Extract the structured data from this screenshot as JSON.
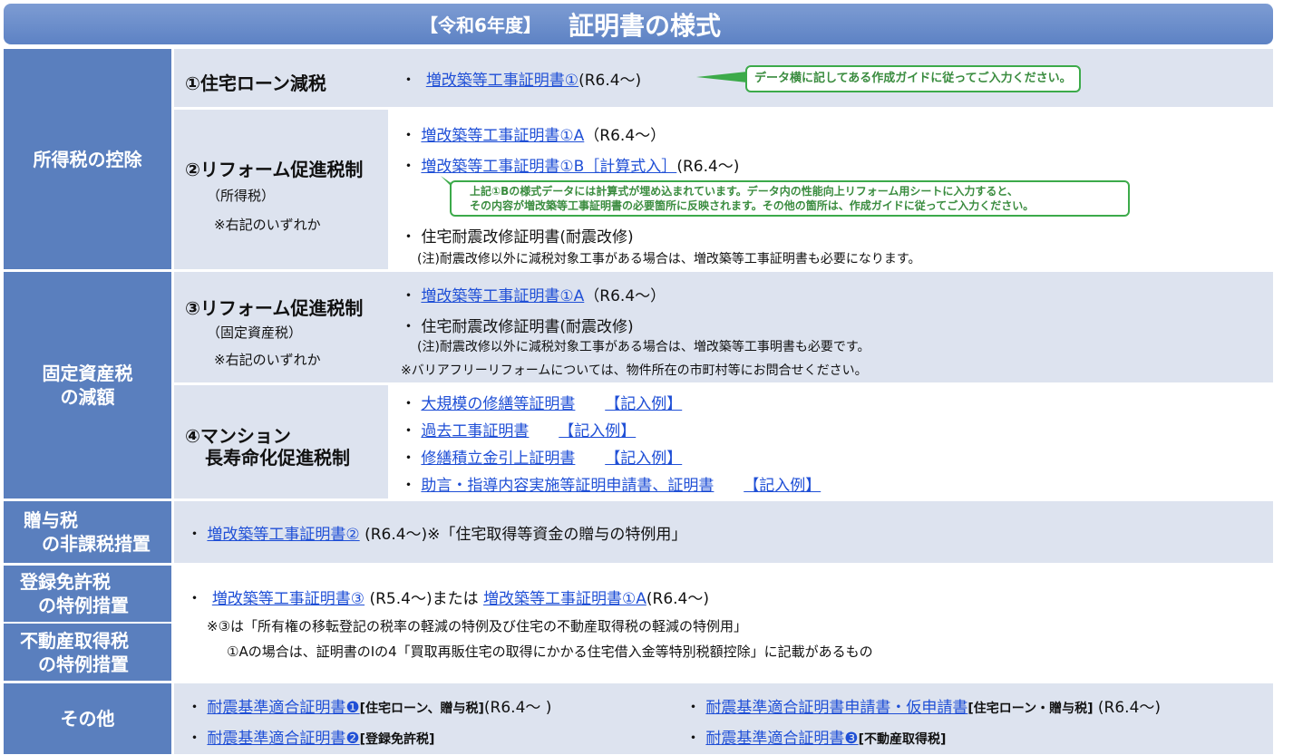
{
  "title": {
    "year": "【令和6年度】",
    "main": "証明書の様式"
  },
  "categories": {
    "income": "所得税の控除",
    "fixed": "固定資産税\nの減額",
    "gift": "贈与税\n　の非課税措置",
    "reg": "登録免許税\n　の特例措置",
    "realestate": "不動産取得税\n　の特例措置",
    "other": "その他"
  },
  "sub": {
    "s1": "①住宅ローン減税",
    "s2": "②リフォーム促進税制",
    "s2_note1": "（所得税）",
    "s2_note2": "※右記のいずれか",
    "s3": "③リフォーム促進税制",
    "s3_note1": "（固定資産税）",
    "s3_note2": "※右記のいずれか",
    "s4a": "④マンション",
    "s4b": "長寿命化促進税制"
  },
  "bullet": "・",
  "r1": {
    "link": "増改築等工事証明書①",
    "suffix": "(R6.4～)",
    "callout": "データ横に記してある作成ガイドに従ってご入力ください。"
  },
  "r2": {
    "l1": "増改築等工事証明書①A",
    "l1s": "（R6.4～）",
    "l2": "増改築等工事証明書①B［計算式入］",
    "l2s": "(R6.4～)",
    "callout1": "上記①Bの様式データには計算式が埋め込まれています。データ内の性能向上リフォーム用シートに入力すると、",
    "callout2": "その内容が増改築等工事証明書の必要箇所に反映されます。その他の箇所は、作成ガイドに従ってご入力ください。",
    "l3": "住宅耐震改修証明書(耐震改修)",
    "note": "(注)耐震改修以外に減税対象工事がある場合は、増改築等工事証明書も必要になります。"
  },
  "r3": {
    "l1": "増改築等工事証明書①A",
    "l1s": "（R6.4～）",
    "l2": "住宅耐震改修証明書(耐震改修)",
    "note1": "(注)耐震改修以外に減税対象工事がある場合は、増改築等工事明書も必要です。",
    "note2": "※バリアフリーリフォームについては、物件所在の市町村等にお問合せください。"
  },
  "r4": {
    "items": [
      {
        "label": "大規模の修繕等証明書",
        "ex": "【記入例】"
      },
      {
        "label": "過去工事証明書",
        "ex": "【記入例】"
      },
      {
        "label": "修繕積立金引上証明書",
        "ex": "【記入例】"
      },
      {
        "label": "助言・指導内容実施等証明申請書、証明書",
        "ex": "【記入例】"
      }
    ]
  },
  "gift": {
    "link": "増改築等工事証明書②",
    "suffix": "(R6.4～)※「住宅取得等資金の贈与の特例用」"
  },
  "reg": {
    "link1": "増改築等工事証明書③",
    "mid": "(R5.4～)または",
    "link2": "増改築等工事証明書①A",
    "suffix": "(R6.4～)",
    "note1": "※③は「所有権の移転登記の税率の軽減の特例及び住宅の不動産取得税の軽減の特例用」",
    "note2": "①Aの場合は、証明書のⅠの4「買取再販住宅の取得にかかる住宅借入金等特別税額控除」に記載があるもの"
  },
  "other": {
    "a1": "耐震基準適合証明書❶",
    "a1s": "[住宅ローン、贈与税]",
    "a1r": "(R6.4～ )",
    "a2": "耐震基準適合証明書申請書・仮申請書",
    "a2s": "[住宅ローン・贈与税]",
    "a2r": "(R6.4～)",
    "b1": "耐震基準適合証明書❷",
    "b1s": "[登録免許税]",
    "b2": "耐震基準適合証明書❸",
    "b2s": "[不動産取得税]"
  },
  "colors": {
    "header": "#5a7fbe",
    "sub": "#dde3ef",
    "link": "#1f4fd6",
    "callout": "#3caa4a"
  }
}
